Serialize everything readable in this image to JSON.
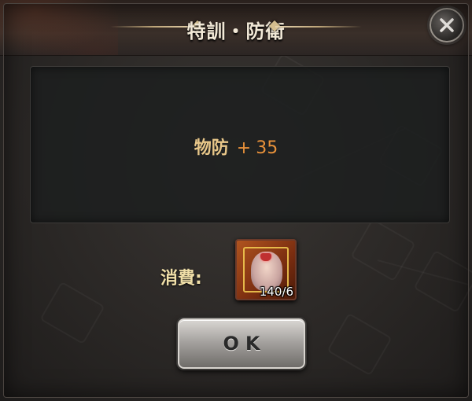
{
  "dialog": {
    "title": "特訓・防衛",
    "close_icon": "close-icon"
  },
  "stat": {
    "name": "物防",
    "sign": "+",
    "value": "35"
  },
  "cost": {
    "label": "消費:",
    "item_icon": "puzzle-piece-portrait-icon",
    "item_count": "140/6"
  },
  "actions": {
    "ok_label": "OK"
  },
  "colors": {
    "stat_name": "#e8c789",
    "stat_value": "#e8913a",
    "cost_label": "#f0dfa8"
  }
}
